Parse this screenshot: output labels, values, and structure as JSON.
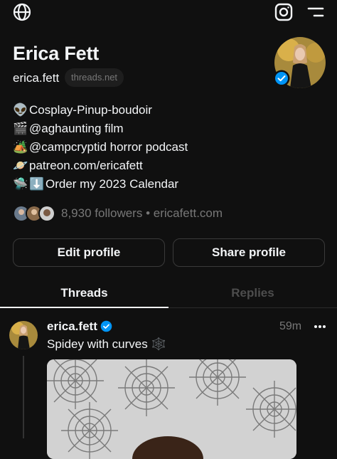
{
  "header": {
    "icons": [
      "globe-icon",
      "instagram-icon",
      "menu-icon"
    ]
  },
  "profile": {
    "name": "Erica Fett",
    "handle": "erica.fett",
    "domain_pill": "threads.net",
    "verified": true,
    "bio": [
      {
        "emoji": "👽",
        "text": "Cosplay-Pinup-boudoir"
      },
      {
        "emoji": "🎬",
        "text": "@aghaunting film"
      },
      {
        "emoji": "🏕️",
        "text": "@campcryptid horror podcast"
      },
      {
        "emoji": "🪐",
        "text": "patreon.com/ericafett"
      },
      {
        "emoji": "🛸",
        "emoji2": "⬇️",
        "text": "Order my 2023 Calendar"
      }
    ],
    "followers_text": "8,930 followers • ericafett.com",
    "edit_button": "Edit profile",
    "share_button": "Share profile"
  },
  "tabs": [
    {
      "label": "Threads",
      "active": true
    },
    {
      "label": "Replies",
      "active": false
    }
  ],
  "post": {
    "username": "erica.fett",
    "time": "59m",
    "text": "Spidey with curves 🕸️"
  },
  "colors": {
    "background": "#101010",
    "text": "#f3f5f7",
    "muted": "#777777",
    "verified": "#0095f6",
    "border": "#3a3a3a"
  }
}
